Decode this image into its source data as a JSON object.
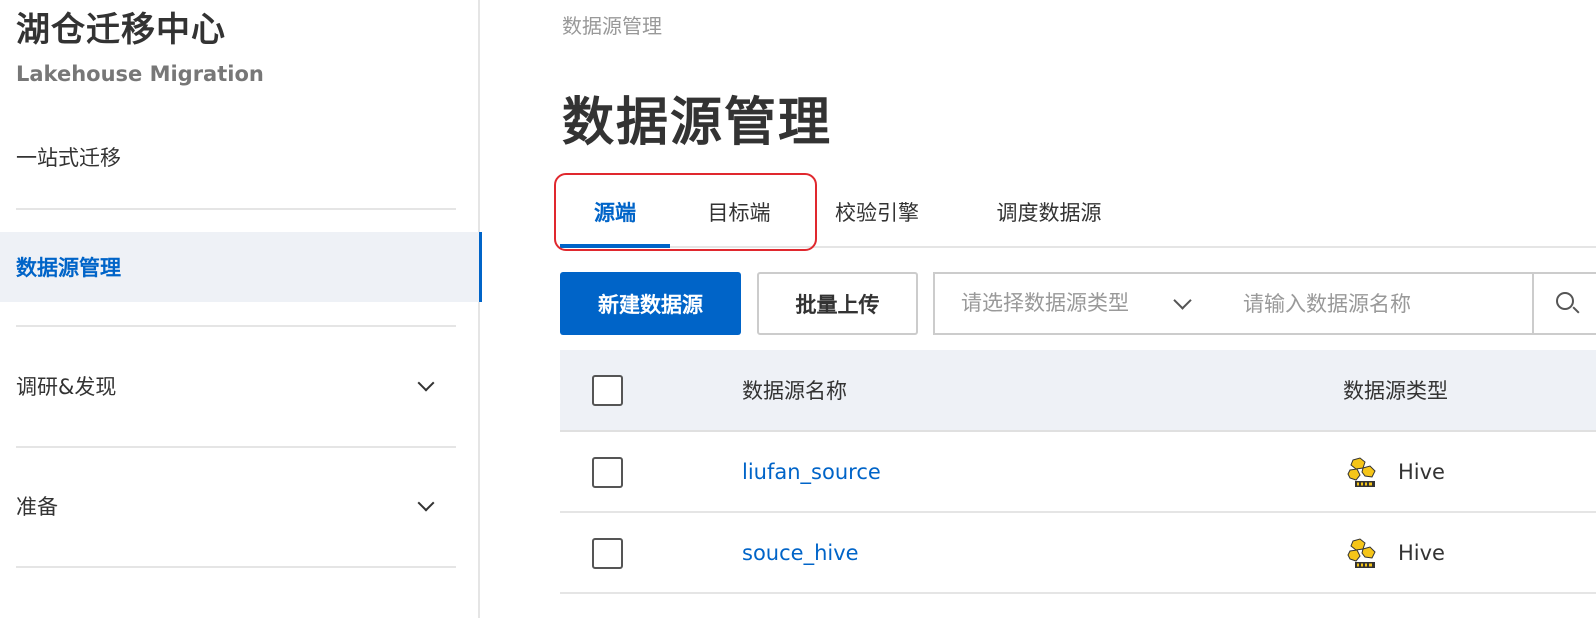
{
  "sidebar": {
    "app_title": "湖仓迁移中心",
    "app_subtitle": "Lakehouse Migration",
    "items": [
      {
        "label": "一站式迁移"
      },
      {
        "label": "数据源管理"
      },
      {
        "label": "调研&发现"
      },
      {
        "label": "准备"
      }
    ]
  },
  "main": {
    "breadcrumb": "数据源管理",
    "title": "数据源管理",
    "tabs": [
      {
        "label": "源端"
      },
      {
        "label": "目标端"
      },
      {
        "label": "校验引擎"
      },
      {
        "label": "调度数据源"
      }
    ],
    "toolbar": {
      "new_label": "新建数据源",
      "batch_label": "批量上传",
      "type_placeholder": "请选择数据源类型",
      "search_placeholder": "请输入数据源名称"
    },
    "table": {
      "headers": {
        "name": "数据源名称",
        "type": "数据源类型"
      },
      "rows": [
        {
          "name": "liufan_source",
          "type": "Hive"
        },
        {
          "name": "souce_hive",
          "type": "Hive"
        }
      ]
    }
  },
  "colors": {
    "accent": "#0064c8",
    "highlight": "#e0282e",
    "hive_yellow": "#f5c518"
  }
}
